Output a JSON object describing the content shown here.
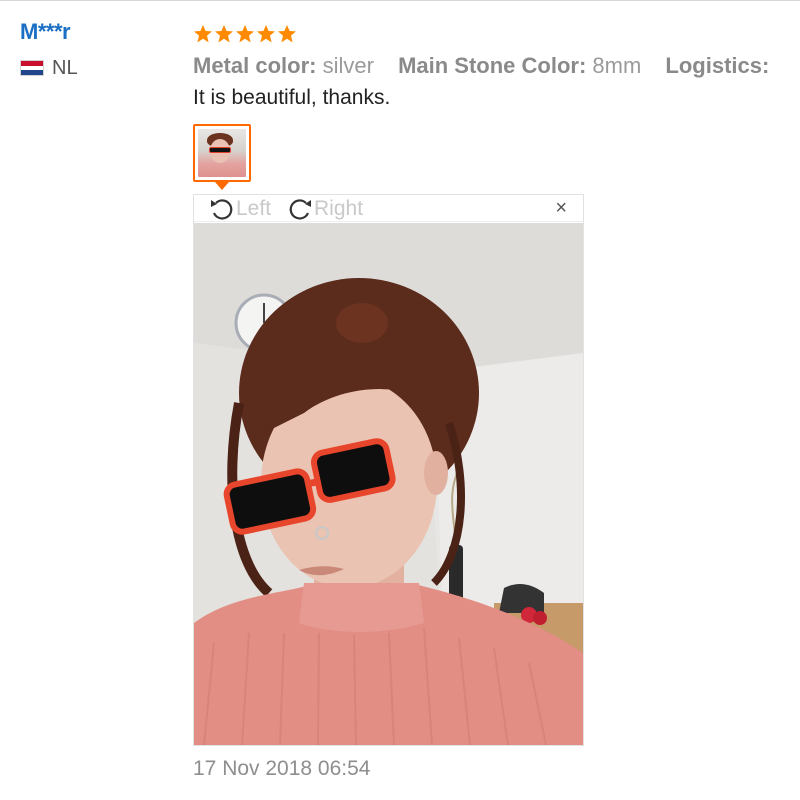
{
  "reviewer": {
    "name": "M***r",
    "country": "NL",
    "flag_colors": [
      "#c8102e",
      "#ffffff",
      "#21468b"
    ]
  },
  "review": {
    "rating": 5,
    "star_color": "#ff8a00",
    "sku": [
      {
        "key": "Metal color:",
        "value": "silver"
      },
      {
        "key": "Main Stone Color:",
        "value": "8mm"
      },
      {
        "key": "Logistics:",
        "value": ""
      }
    ],
    "text": "It is beautiful, thanks.",
    "timestamp": "17 Nov 2018 06:54"
  },
  "viewer": {
    "rotate_left_label": "Left",
    "rotate_right_label": "Right",
    "close_label": "×",
    "accent": "#ff6a00"
  },
  "icons": {
    "rotate_left": "rotate-left-icon",
    "rotate_right": "rotate-right-icon",
    "close": "close-icon",
    "star": "star-icon"
  }
}
